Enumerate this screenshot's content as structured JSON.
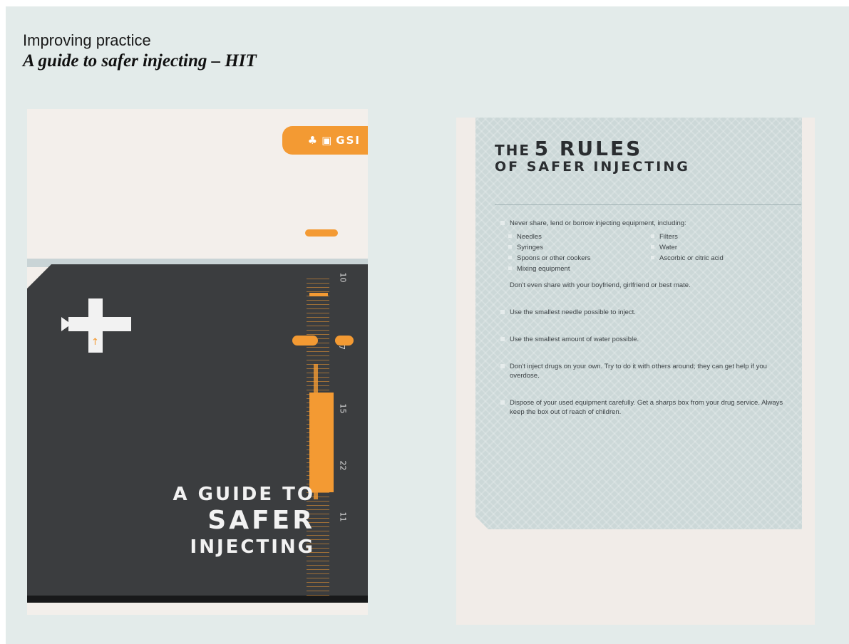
{
  "heading": {
    "kicker": "Improving practice",
    "subtitle": "A guide to safer injecting – HIT"
  },
  "cover": {
    "tab_text": "GSI",
    "title_line1": "A GUIDE TO",
    "title_line2": "SAFER",
    "title_line3": "INJECTING",
    "scale_labels": [
      "10",
      "7",
      "15",
      "22",
      "11"
    ],
    "colors": {
      "accent": "#f39a33",
      "dark": "#3b3d3f",
      "paper": "#f3efeb"
    }
  },
  "rules": {
    "title_the": "THE",
    "title_big": "5 RULES",
    "title_row2": "OF SAFER INJECTING",
    "rule1_text": "Never share, lend or borrow injecting equipment, including:",
    "equipment": [
      "Needles",
      "Filters",
      "Syringes",
      "Water",
      "Spoons or other cookers",
      "Ascorbic or citric acid",
      "Mixing equipment"
    ],
    "rule1_note": "Don't even share with your boyfriend, girlfriend or best mate.",
    "rule2": "Use the smallest needle possible to inject.",
    "rule3": "Use the smallest amount of water possible.",
    "rule4": "Don't inject drugs on your own. Try to do it with others around; they can get help if you overdose.",
    "rule5": "Dispose of your used equipment carefully. Get a sharps box from your drug service. Always keep the box out of reach of children.",
    "colors": {
      "card": "#f1ece8",
      "panel": "#ccd8d8",
      "text": "#3d4346"
    }
  },
  "background_color": "#e3ebea"
}
